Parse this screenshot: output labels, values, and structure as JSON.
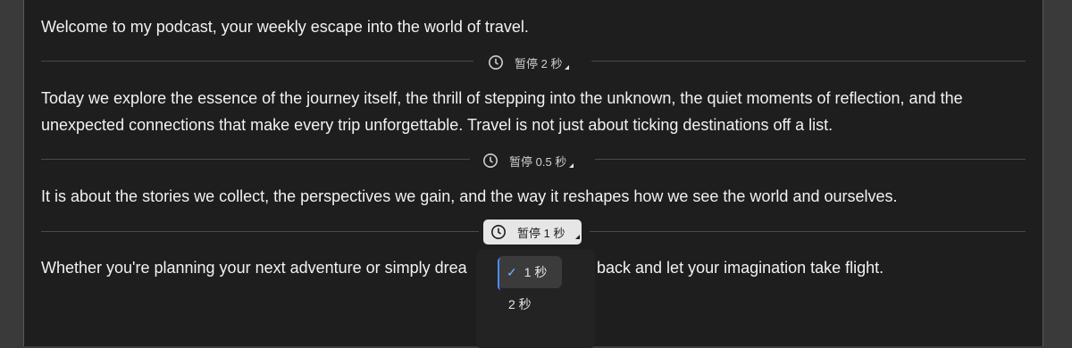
{
  "paragraphs": [
    "Welcome to my podcast, your weekly escape into the world of travel.",
    "Today we explore the essence of the journey itself, the thrill of stepping into the unknown, the quiet moments of reflection, and the",
    "unexpected connections that make every trip unforgettable. Travel is not just about ticking destinations off a list.",
    " It is about the stories we collect, the perspectives we gain, and the way it reshapes how we see the world and ourselves.",
    "Whether you're planning your next adventure or simply drea",
    "back and let your imagination take flight."
  ],
  "pauses": [
    {
      "label": "暂停 2 秒",
      "icon": "clock-icon"
    },
    {
      "label": "暂停 0.5 秒",
      "icon": "clock-icon"
    },
    {
      "label": "暂停 1 秒",
      "icon": "clock-icon",
      "active": true
    }
  ],
  "dropdown": {
    "options": [
      "1 秒",
      "2 秒"
    ],
    "selected": "1 秒",
    "check": "✓"
  },
  "colors": {
    "background": "#1e1e1e",
    "text": "#f2f2f2",
    "accent": "#4a8cff"
  }
}
